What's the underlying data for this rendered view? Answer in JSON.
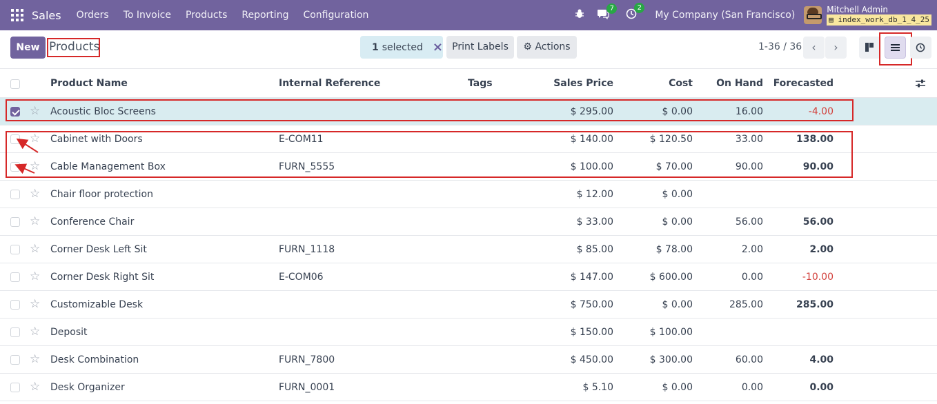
{
  "navbar": {
    "app_name": "Sales",
    "menu": [
      "Orders",
      "To Invoice",
      "Products",
      "Reporting",
      "Configuration"
    ],
    "messages_count": "7",
    "activities_count": "2",
    "company": "My Company (San Francisco)",
    "user_name": "Mitchell Admin",
    "db_name": "index_work_db_1_4_25"
  },
  "control": {
    "new_label": "New",
    "breadcrumb": "Products",
    "selected_count": "1",
    "selected_label": "selected",
    "print_labels": "Print Labels",
    "actions": "Actions",
    "pager": "1-36 / 36"
  },
  "table": {
    "columns": [
      "Product Name",
      "Internal Reference",
      "Tags",
      "Sales Price",
      "Cost",
      "On Hand",
      "Forecasted"
    ],
    "rows": [
      {
        "name": "Acoustic Bloc Screens",
        "ref": "",
        "tags": "",
        "price": "$ 295.00",
        "cost": "$ 0.00",
        "onhand": "16.00",
        "forecast": "-4.00",
        "selected": true,
        "forecast_style": "neg"
      },
      {
        "name": "Cabinet with Doors",
        "ref": "E-COM11",
        "tags": "",
        "price": "$ 140.00",
        "cost": "$ 120.50",
        "onhand": "33.00",
        "forecast": "138.00",
        "selected": false,
        "forecast_style": "bold"
      },
      {
        "name": "Cable Management Box",
        "ref": "FURN_5555",
        "tags": "",
        "price": "$ 100.00",
        "cost": "$ 70.00",
        "onhand": "90.00",
        "forecast": "90.00",
        "selected": false,
        "forecast_style": "bold"
      },
      {
        "name": "Chair floor protection",
        "ref": "",
        "tags": "",
        "price": "$ 12.00",
        "cost": "$ 0.00",
        "onhand": "",
        "forecast": "",
        "selected": false,
        "forecast_style": "bold"
      },
      {
        "name": "Conference Chair",
        "ref": "",
        "tags": "",
        "price": "$ 33.00",
        "cost": "$ 0.00",
        "onhand": "56.00",
        "forecast": "56.00",
        "selected": false,
        "forecast_style": "bold"
      },
      {
        "name": "Corner Desk Left Sit",
        "ref": "FURN_1118",
        "tags": "",
        "price": "$ 85.00",
        "cost": "$ 78.00",
        "onhand": "2.00",
        "forecast": "2.00",
        "selected": false,
        "forecast_style": "bold"
      },
      {
        "name": "Corner Desk Right Sit",
        "ref": "E-COM06",
        "tags": "",
        "price": "$ 147.00",
        "cost": "$ 600.00",
        "onhand": "0.00",
        "forecast": "-10.00",
        "selected": false,
        "forecast_style": "neg"
      },
      {
        "name": "Customizable Desk",
        "ref": "",
        "tags": "",
        "price": "$ 750.00",
        "cost": "$ 0.00",
        "onhand": "285.00",
        "forecast": "285.00",
        "selected": false,
        "forecast_style": "bold"
      },
      {
        "name": "Deposit",
        "ref": "",
        "tags": "",
        "price": "$ 150.00",
        "cost": "$ 100.00",
        "onhand": "",
        "forecast": "",
        "selected": false,
        "forecast_style": "bold"
      },
      {
        "name": "Desk Combination",
        "ref": "FURN_7800",
        "tags": "",
        "price": "$ 450.00",
        "cost": "$ 300.00",
        "onhand": "60.00",
        "forecast": "4.00",
        "selected": false,
        "forecast_style": "bold"
      },
      {
        "name": "Desk Organizer",
        "ref": "FURN_0001",
        "tags": "",
        "price": "$ 5.10",
        "cost": "$ 0.00",
        "onhand": "0.00",
        "forecast": "0.00",
        "selected": false,
        "forecast_style": "bold"
      }
    ]
  },
  "icons": {
    "apps": "apps-grid-icon",
    "bug": "bug-icon",
    "chat": "chat-icon",
    "clock": "activity-clock-icon",
    "close": "close-icon",
    "gear": "gear-icon",
    "kanban": "kanban-view-icon",
    "list": "list-view-icon",
    "activity": "activity-view-icon",
    "settings": "optional-columns-icon",
    "star": "star-icon"
  },
  "colors": {
    "brand": "#71639e",
    "selected_row": "#d9ecf0",
    "negative": "#d23f3a",
    "highlight": "#d62828"
  }
}
